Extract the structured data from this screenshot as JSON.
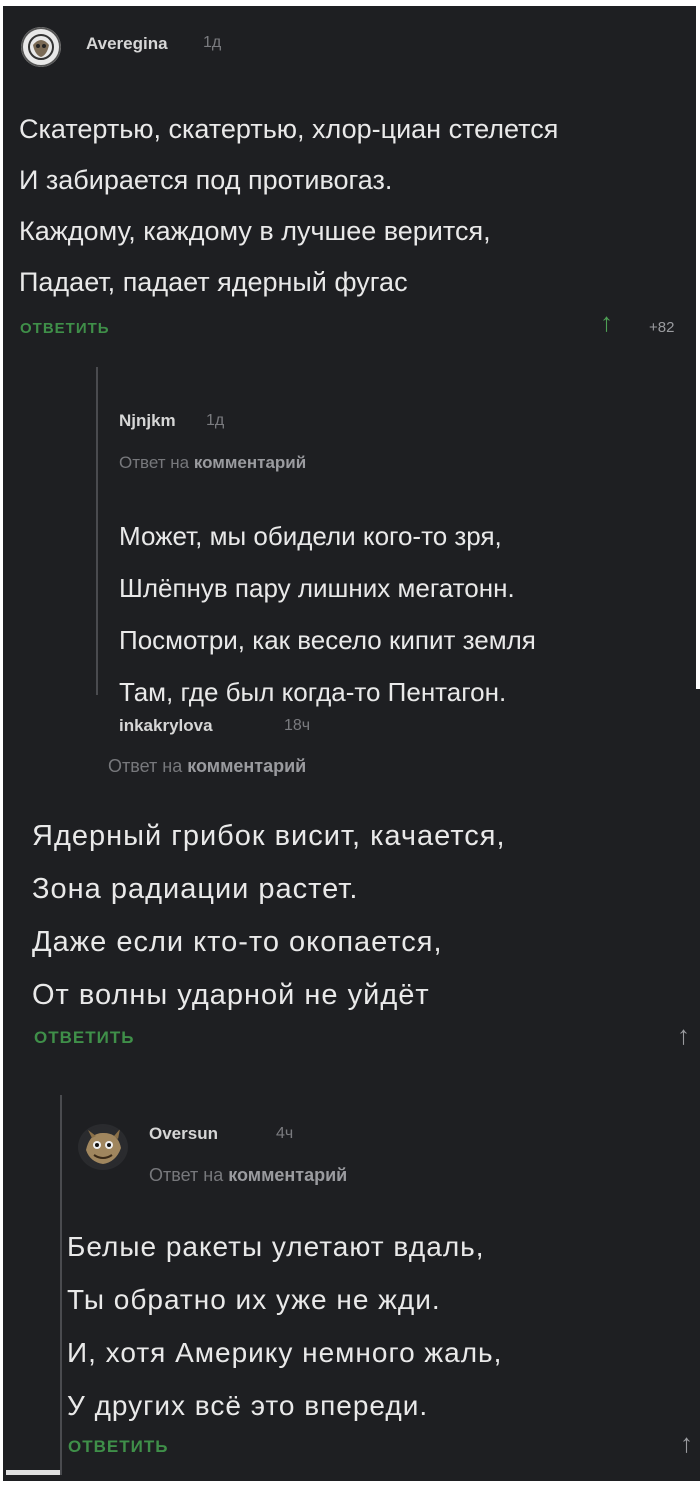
{
  "comments": [
    {
      "author": "Averegina",
      "time": "1д",
      "lines": [
        "Скатертью, скатертью, хлор-циан стелется",
        "И забирается под противогаз.",
        "Каждому, каждому в лучшее верится,",
        "Падает, падает ядерный фугас"
      ],
      "reply_label": "ОТВЕТИТЬ",
      "rating": "+82"
    },
    {
      "author": "Njnjkm",
      "time": "1д",
      "reply_prefix": "Ответ на",
      "reply_target": "комментарий",
      "lines": [
        "Может, мы обидели кого-то зря,",
        "Шлёпнув пару лишних мегатонн.",
        "Посмотри, как весело кипит земля",
        "Там, где был когда-то Пентагон."
      ]
    },
    {
      "author": "inkakrylova",
      "time": "18ч",
      "reply_prefix": "Ответ на",
      "reply_target": "комментарий",
      "lines": [
        "Ядерный грибок висит, качается,",
        "Зона радиации растет.",
        "Даже если кто-то окопается,",
        "От волны ударной не уйдёт"
      ],
      "reply_label": "ОТВЕТИТЬ"
    },
    {
      "author": "Oversun",
      "time": "4ч",
      "reply_prefix": "Ответ на",
      "reply_target": "комментарий",
      "lines": [
        "Белые ракеты улетают вдаль,",
        "Ты обратно их уже не жди.",
        "И, хотя Америку немного жаль,",
        "У других всё это впереди."
      ],
      "reply_label": "ОТВЕТИТЬ"
    }
  ],
  "icons": {
    "upvote": "arrow-up-icon",
    "avatar": "avatar-icon"
  },
  "colors": {
    "background": "#1e1f22",
    "text": "#e9e9e9",
    "accent_green": "#3f8f49",
    "muted": "#77787c"
  }
}
